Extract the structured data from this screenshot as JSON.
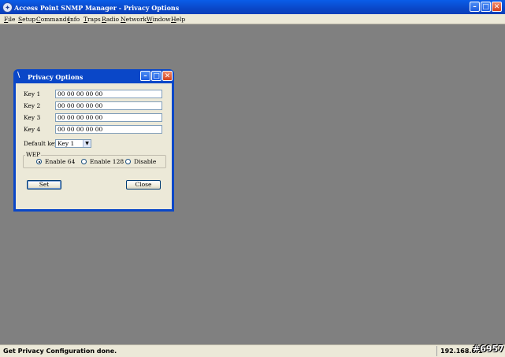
{
  "app": {
    "title": "Access Point SNMP Manager -  Privacy Options",
    "minimize": "–",
    "maximize": "□",
    "close": "✕"
  },
  "menu": [
    "File",
    "Setup",
    "Commands",
    "Info",
    "Traps",
    "Radio",
    "Network",
    "Window",
    "Help"
  ],
  "dialog": {
    "title": "Privacy Options",
    "keys": [
      {
        "label": "Key 1",
        "value": "00 00 00 00 00"
      },
      {
        "label": "Key 2",
        "value": "00 00 00 00 00"
      },
      {
        "label": "Key 3",
        "value": "00 00 00 00 00"
      },
      {
        "label": "Key 4",
        "value": "00 00 00 00 00"
      }
    ],
    "default_key_label": "Default key",
    "default_key_value": "Key 1",
    "wep_label": "WEP",
    "wep_options": [
      "Enable 64",
      "Enable 128",
      "Disable"
    ],
    "wep_selected": "Enable 64",
    "set_label": "Set",
    "close_label": "Close"
  },
  "status": {
    "message": "Get Privacy Configuration done.",
    "ip": "192.168.0.1"
  },
  "watermark": "#6957",
  "colors": {
    "titlebar": "#0a47c8",
    "desktop": "#808080",
    "dialog_face": "#ece9d8"
  }
}
